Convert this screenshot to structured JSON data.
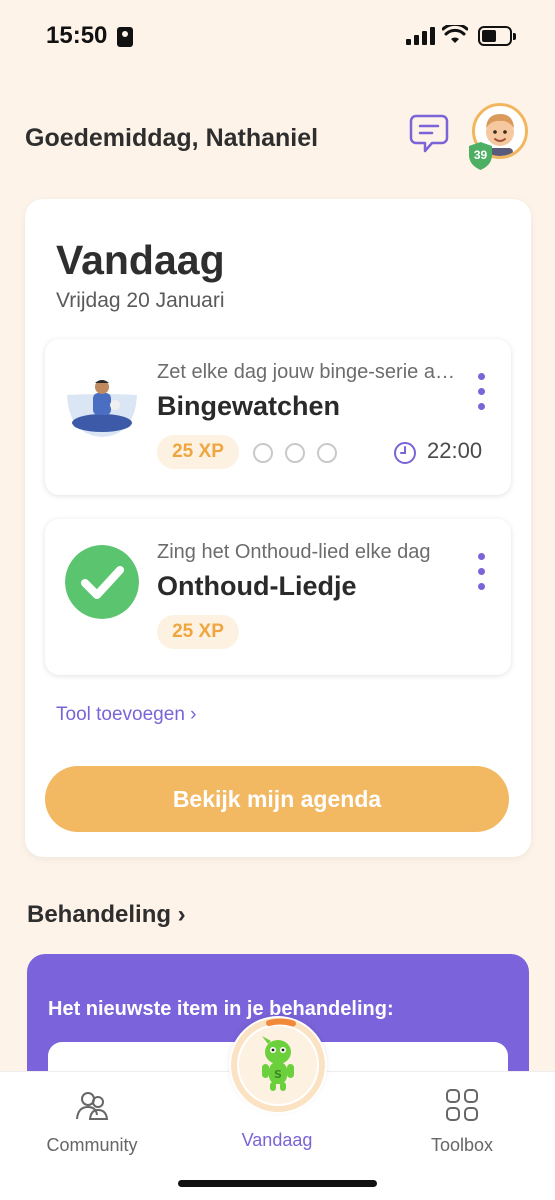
{
  "status_bar": {
    "time": "15:50"
  },
  "header": {
    "greeting": "Goedemiddag, Nathaniel",
    "level": "39"
  },
  "today": {
    "title": "Vandaag",
    "date": "Vrijdag 20 Januari",
    "tasks": [
      {
        "subtitle": "Zet elke dag jouw binge-serie aan",
        "title": "Bingewatchen",
        "xp": "25 XP",
        "time": "22:00",
        "completed": false
      },
      {
        "subtitle": "Zing het Onthoud-lied elke dag",
        "title": "Onthoud-Liedje",
        "xp": "25 XP",
        "completed": true
      }
    ],
    "add_tool": "Tool toevoegen ›",
    "agenda_button": "Bekijk mijn agenda"
  },
  "treatment": {
    "heading": "Behandeling ›",
    "latest_label": "Het nieuwste item in je behandeling:"
  },
  "tab_bar": {
    "tabs": [
      {
        "label": "Community",
        "icon": "people-icon"
      },
      {
        "label": "Vandaag",
        "icon": "mascot-icon"
      },
      {
        "label": "Toolbox",
        "icon": "grid-icon"
      }
    ],
    "active": "Vandaag"
  },
  "colors": {
    "background": "#fdf3e9",
    "accent_purple": "#7b63d8",
    "accent_orange": "#f3b862",
    "success_green": "#5bc46e"
  }
}
